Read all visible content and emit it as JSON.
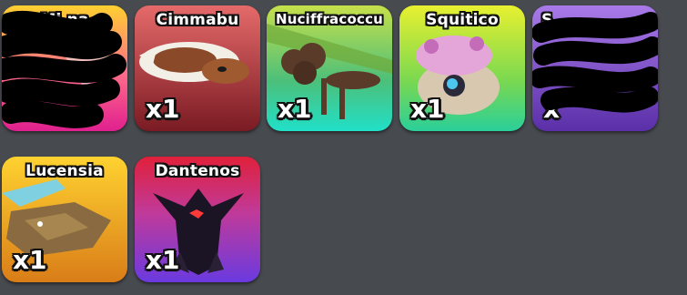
{
  "inventory": {
    "cards": [
      {
        "name": "Mi      na",
        "quantity": ""
      },
      {
        "name": "Cimmabu",
        "quantity": "x1"
      },
      {
        "name": "Nuciffracoccu",
        "quantity": "x1"
      },
      {
        "name": "Squitico",
        "quantity": "x1"
      },
      {
        "name": "S",
        "quantity": "x"
      },
      {
        "name": "Lucensia",
        "quantity": "x1"
      },
      {
        "name": "Dantenos",
        "quantity": "x1"
      }
    ]
  },
  "colors": {
    "background": "#474a4f",
    "card_magenta": "#e0208f",
    "card_red": "#b0323a",
    "card_green": "#2fd8a0",
    "card_yellowgreen": "#c8e23a",
    "card_purple": "#8a56d8",
    "card_orange": "#e09a1e",
    "card_legendary": "#8a2bd0"
  }
}
